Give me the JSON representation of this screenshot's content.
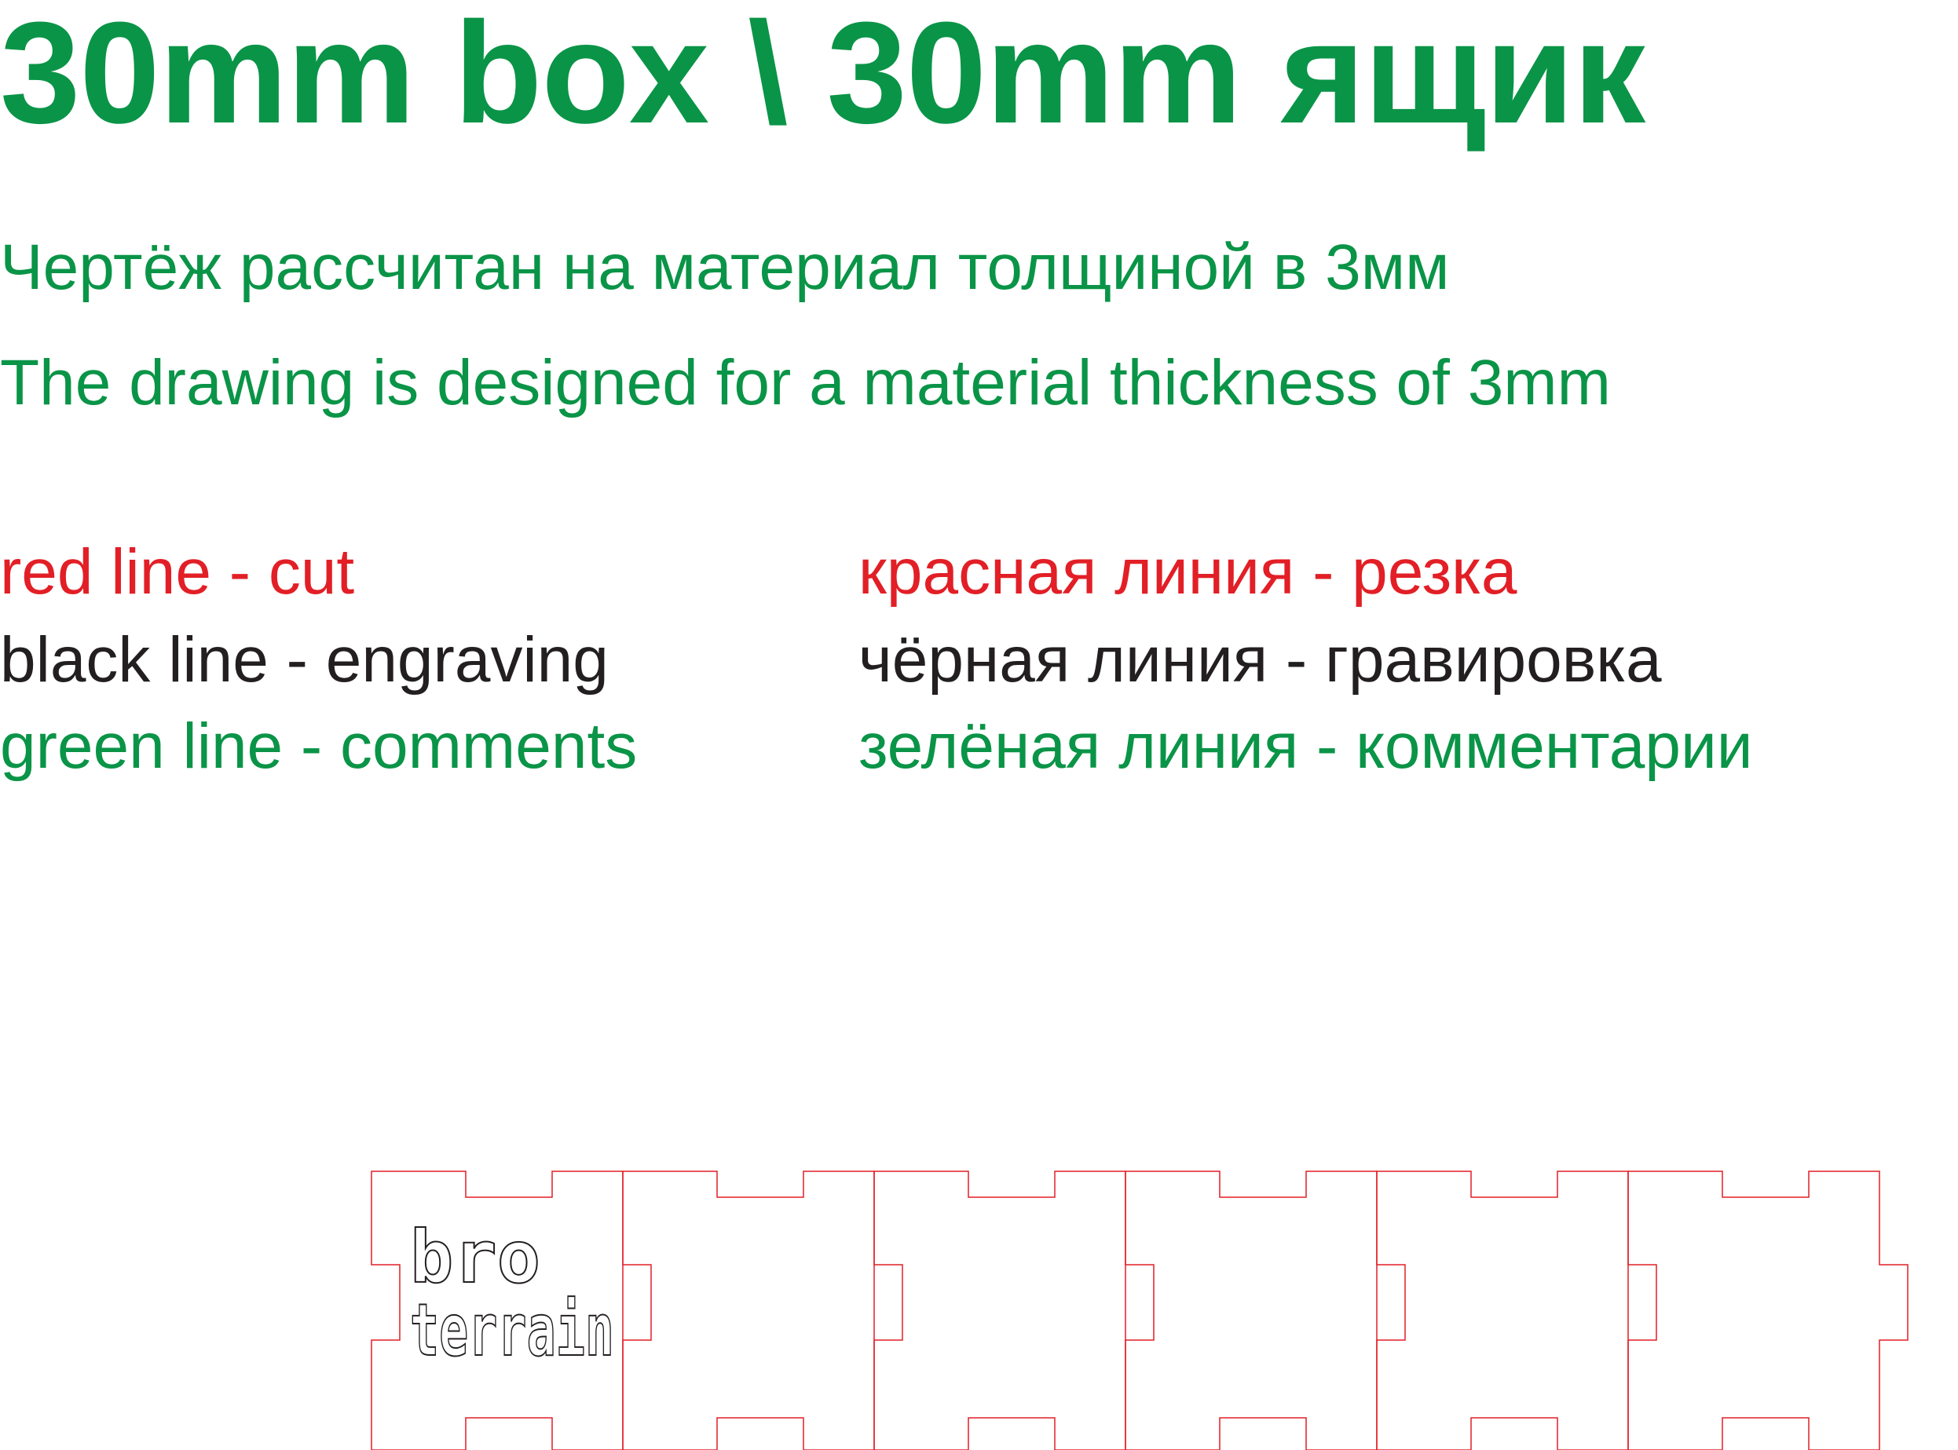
{
  "title": "30mm box \\ 30mm ящик",
  "subtitle_ru": "Чертёж рассчитан на материал толщиной в 3мм",
  "subtitle_en": "The drawing is designed for a material thickness of 3mm",
  "legend": {
    "en": {
      "red": "red line - cut",
      "black": "black line - engraving",
      "green": "green line - comments"
    },
    "ru": {
      "red": "красная линия - резка",
      "black": "чёрная линия - гравировка",
      "green": "зелёная линия - комментарии"
    }
  },
  "logo": {
    "line1": "bro",
    "line2": "terrain"
  },
  "colors": {
    "cut": "#e21f26",
    "engraving": "#231f20",
    "comments": "#0a9447"
  },
  "panel_count": 6
}
